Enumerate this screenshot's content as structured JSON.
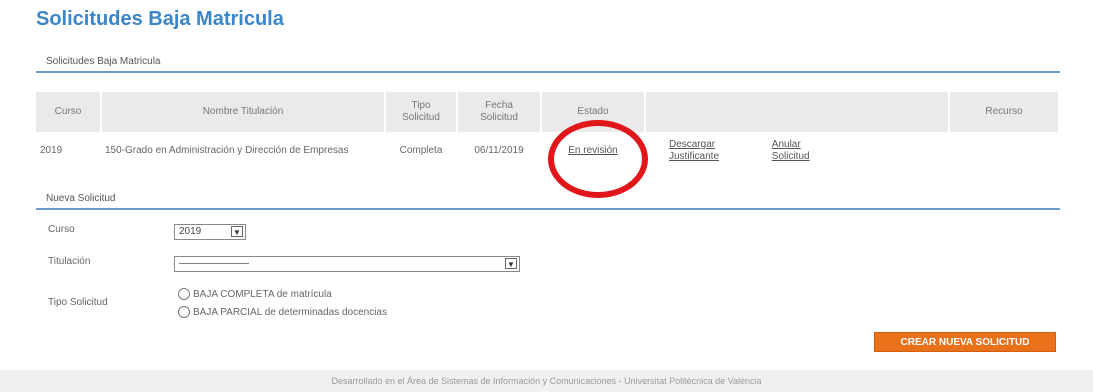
{
  "page_title": "Solicitudes Baja Matricula",
  "requests_section": {
    "title": "Solicitudes Baja Matricula",
    "columns": {
      "curso": "Curso",
      "titulacion": "Nombre Titulación",
      "tipo": "Tipo\nSolicitud",
      "fecha": "Fecha\nSolicitud",
      "estado": "Estado",
      "recurso": "Recurso"
    },
    "rows": [
      {
        "curso": "2019",
        "titulacion": "150-Grado en Administración y Dirección de Empresas",
        "tipo": "Completa",
        "fecha": "06/11/2019",
        "estado": "En revisión",
        "descargar": "Descargar Justificante",
        "anular": "Anular Solicitud"
      }
    ]
  },
  "new_request": {
    "title": "Nueva Solicitud",
    "curso_label": "Curso",
    "curso_value": "2019",
    "titulacion_label": "Titulación",
    "titulacion_value": "———————",
    "tipo_label": "Tipo Solicitud",
    "option_completa": "BAJA COMPLETA de matrícula",
    "option_parcial": "BAJA PARCIAL de determinadas docencias",
    "create_button": "CREAR NUEVA SOLICITUD"
  },
  "footer": "Desarrollado en el Área de Sistemas de Información y Comunicaciones - Universitat Politècnica de València",
  "colors": {
    "title_blue": "#3a86c8",
    "rule_blue": "#6a9bc9",
    "button_orange": "#e8711a",
    "annotation_red": "#e1161b"
  }
}
